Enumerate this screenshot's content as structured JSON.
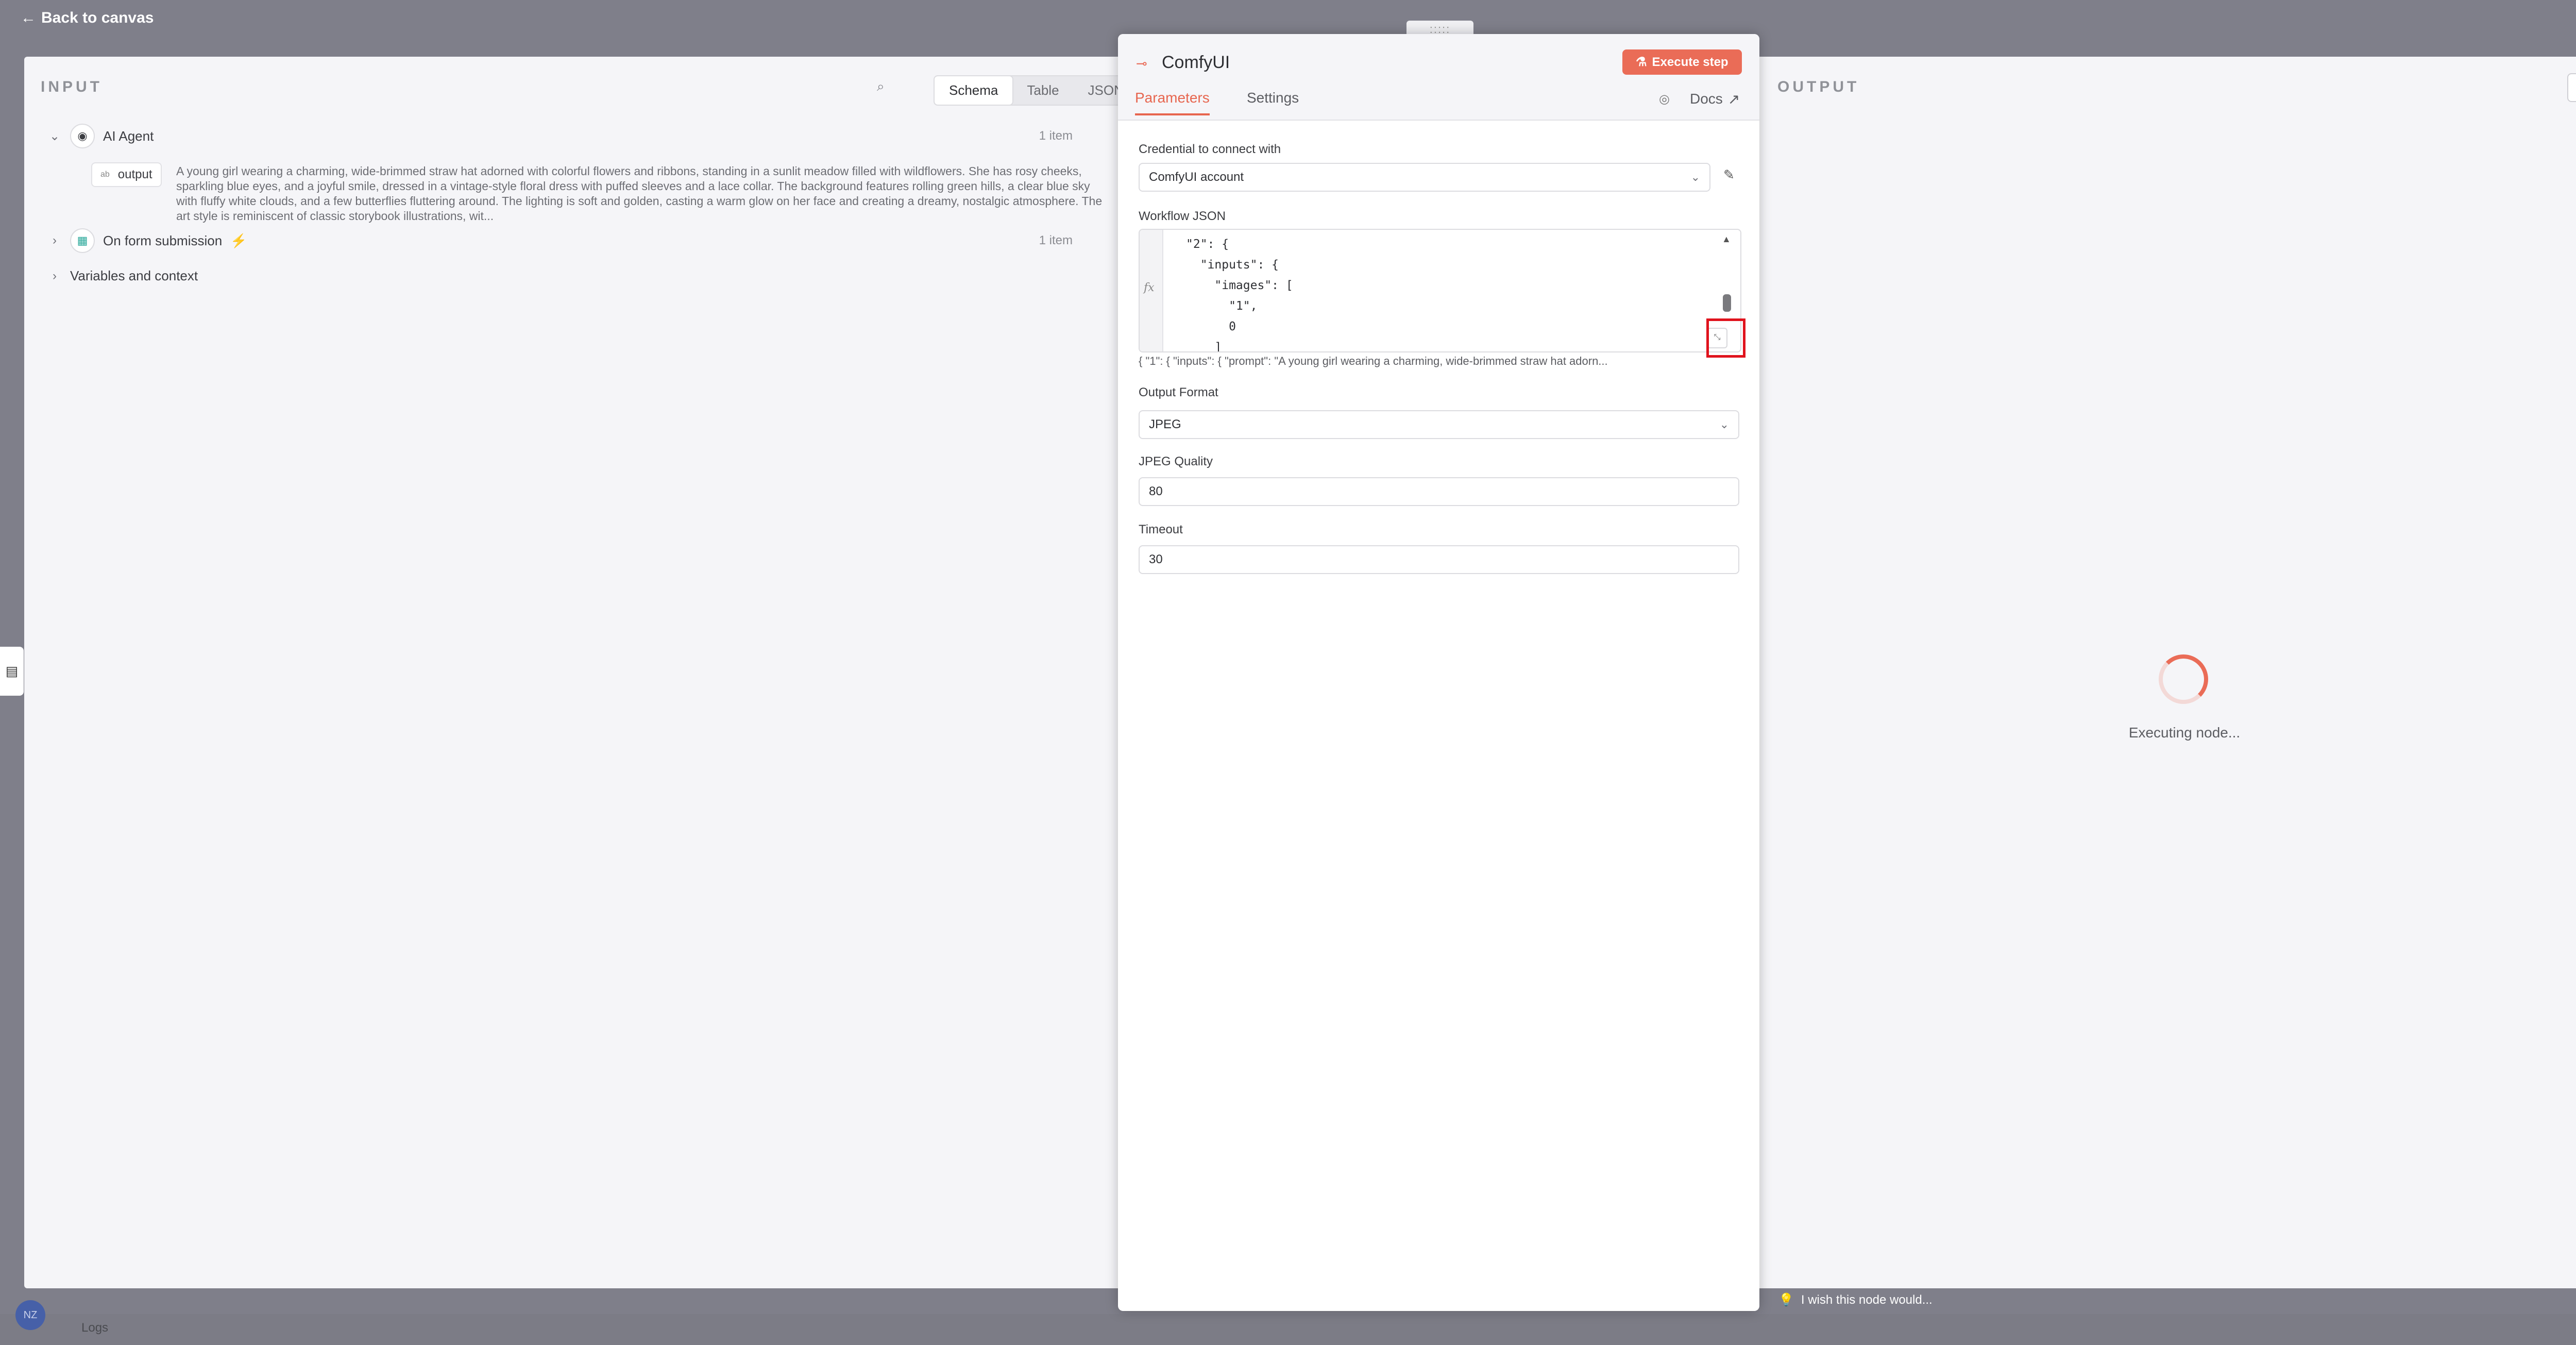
{
  "topbar": {
    "back_label": "Back to canvas"
  },
  "input_panel": {
    "title": "INPUT",
    "tabs": [
      "Schema",
      "Table",
      "JSON"
    ],
    "active_tab": "Schema",
    "nodes": [
      {
        "name": "AI Agent",
        "count": "1 item",
        "expanded": true
      },
      {
        "name": "On form submission",
        "count": "1 item",
        "expanded": false
      },
      {
        "name": "Variables and context",
        "expanded": false
      }
    ],
    "output_field": {
      "label": "output",
      "type_badge": "ab",
      "value": "A young girl wearing a charming, wide-brimmed straw hat adorned with colorful flowers and ribbons, standing in a sunlit meadow filled with wildflowers. She has rosy cheeks, sparkling blue eyes, and a joyful smile, dressed in a vintage-style floral dress with puffed sleeves and a lace collar. The background features rolling green hills, a clear blue sky with fluffy white clouds, and a few butterflies fluttering around. The lighting is soft and golden, casting a warm glow on her face and creating a dreamy, nostalgic atmosphere. The art style is reminiscent of classic storybook illustrations, wit..."
    }
  },
  "node_panel": {
    "title": "ComfyUI",
    "execute_label": "Execute step",
    "tabs": [
      "Parameters",
      "Settings"
    ],
    "active_tab": "Parameters",
    "docs_label": "Docs",
    "credential": {
      "label": "Credential to connect with",
      "value": "ComfyUI account"
    },
    "workflow": {
      "label": "Workflow JSON",
      "fx": "fx",
      "code_lines": [
        "\"2\": {",
        "  \"inputs\": {",
        "    \"images\": [",
        "      \"1\",",
        "      0",
        "    ]"
      ],
      "preview": "{   \"1\": {     \"inputs\": {       \"prompt\": \"A young girl wearing a charming, wide-brimmed straw hat adorn..."
    },
    "output_format": {
      "label": "Output Format",
      "value": "JPEG"
    },
    "jpeg_quality": {
      "label": "JPEG Quality",
      "value": "80"
    },
    "timeout": {
      "label": "Timeout",
      "value": "30"
    }
  },
  "output_panel": {
    "title": "OUTPUT",
    "status": "Executing node..."
  },
  "footer": {
    "wish_label": "I wish this node would...",
    "logs_label": "Logs",
    "avatar": "NZ"
  },
  "colors": {
    "accent": "#ea6c57",
    "highlight": "#e0131d"
  }
}
